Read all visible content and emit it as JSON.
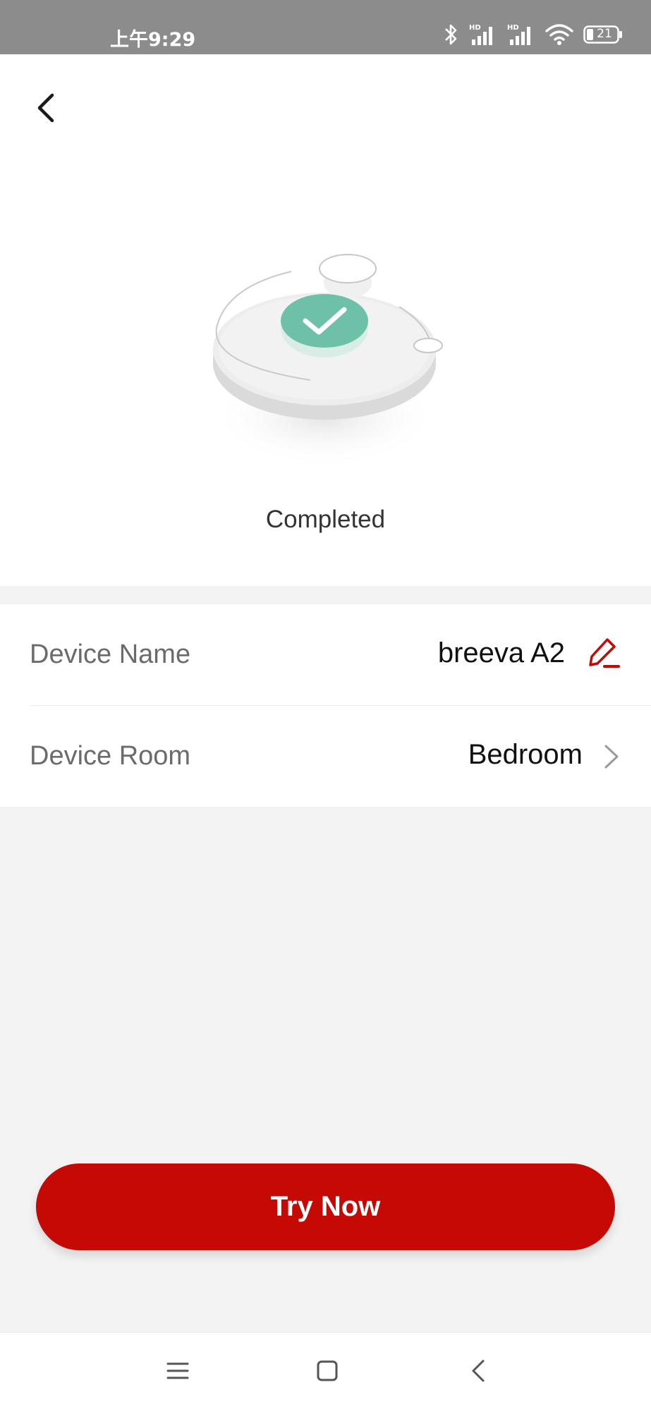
{
  "status_bar": {
    "time": "上午9:29",
    "battery": "21",
    "icons": [
      "bluetooth-icon",
      "signal-hd-icon",
      "signal-hd-icon",
      "wifi-icon",
      "battery-icon"
    ]
  },
  "header": {
    "back_icon": "chevron-left-icon"
  },
  "illustration": {
    "icon": "device-completed-illustration",
    "check_color": "#6ec1a8"
  },
  "status": {
    "label": "Completed"
  },
  "device_info": {
    "name_label": "Device Name",
    "name_value": "breeva A2",
    "name_action_icon": "edit-icon",
    "room_label": "Device Room",
    "room_value": "Bedroom",
    "room_action_icon": "chevron-right-icon"
  },
  "actions": {
    "primary_label": "Try Now",
    "primary_color": "#c50a06"
  },
  "nav_bar": {
    "icons": [
      "menu-icon",
      "home-icon",
      "back-icon"
    ]
  }
}
